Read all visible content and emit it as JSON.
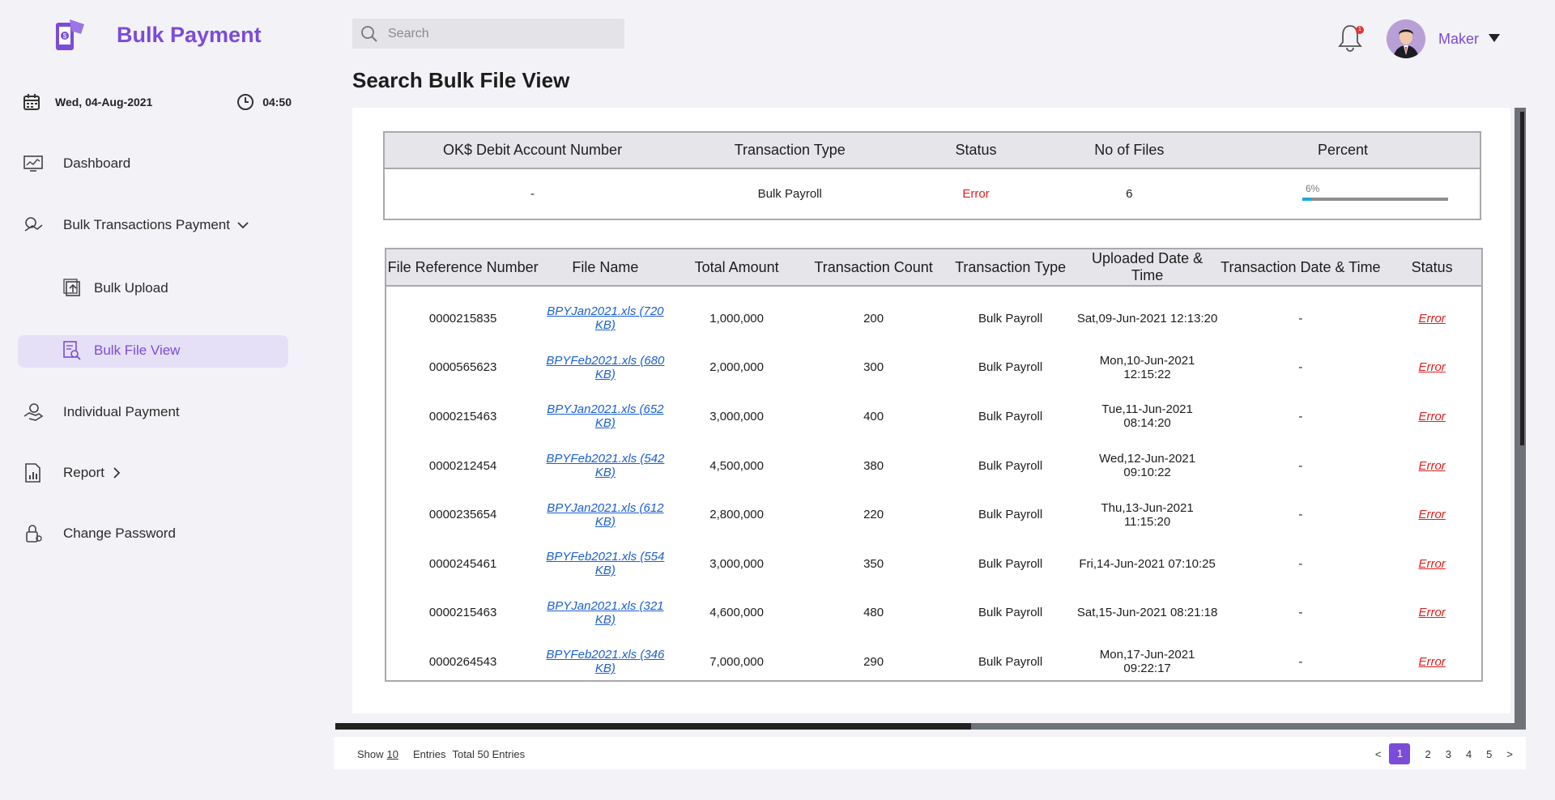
{
  "brand": {
    "title": "Bulk Payment"
  },
  "datebar": {
    "date": "Wed, 04-Aug-2021",
    "time": "04:50"
  },
  "sidebar": {
    "items": [
      {
        "label": "Dashboard"
      },
      {
        "label": "Bulk Transactions Payment"
      },
      {
        "label": "Bulk Upload"
      },
      {
        "label": "Bulk File View"
      },
      {
        "label": "Individual Payment"
      },
      {
        "label": "Report"
      },
      {
        "label": "Change Password"
      }
    ]
  },
  "search": {
    "placeholder": "Search"
  },
  "header": {
    "user": "Maker",
    "notification_count": "1"
  },
  "page": {
    "title": "Search Bulk File View"
  },
  "summary": {
    "headers": [
      "OK$ Debit Account Number",
      "Transaction Type",
      "Status",
      "No of Files",
      "Percent"
    ],
    "row": {
      "account": "-",
      "type": "Bulk Payroll",
      "status": "Error",
      "files": "6",
      "percent_label": "6%",
      "percent_value": 6
    }
  },
  "files": {
    "headers": [
      "File Reference Number",
      "File Name",
      "Total Amount",
      "Transaction Count",
      "Transaction Type",
      "Uploaded Date & Time",
      "Transaction Date & Time",
      "Status"
    ],
    "rows": [
      [
        "0000215835",
        "BPYJan2021.xls (720 KB)",
        "1,000,000",
        "200",
        "Bulk Payroll",
        "Sat,09-Jun-2021 12:13:20",
        "-",
        "Error"
      ],
      [
        "0000565623",
        "BPYFeb2021.xls (680 KB)",
        "2,000,000",
        "300",
        "Bulk Payroll",
        "Mon,10-Jun-2021 12:15:22",
        "-",
        "Error"
      ],
      [
        "0000215463",
        "BPYJan2021.xls (652 KB)",
        "3,000,000",
        "400",
        "Bulk Payroll",
        "Tue,11-Jun-2021 08:14:20",
        "-",
        "Error"
      ],
      [
        "0000212454",
        "BPYFeb2021.xls (542 KB)",
        "4,500,000",
        "380",
        "Bulk Payroll",
        "Wed,12-Jun-2021 09:10:22",
        "-",
        "Error"
      ],
      [
        "0000235654",
        "BPYJan2021.xls (612 KB)",
        "2,800,000",
        "220",
        "Bulk Payroll",
        "Thu,13-Jun-2021 11:15:20",
        "-",
        "Error"
      ],
      [
        "0000245461",
        "BPYFeb2021.xls (554 KB)",
        "3,000,000",
        "350",
        "Bulk Payroll",
        "Fri,14-Jun-2021 07:10:25",
        "-",
        "Error"
      ],
      [
        "0000215463",
        "BPYJan2021.xls (321 KB)",
        "4,600,000",
        "480",
        "Bulk Payroll",
        "Sat,15-Jun-2021 08:21:18",
        "-",
        "Error"
      ],
      [
        "0000264543",
        "BPYFeb2021.xls (346 KB)",
        "7,000,000",
        "290",
        "Bulk Payroll",
        "Mon,17-Jun-2021 09:22:17",
        "-",
        "Error"
      ]
    ]
  },
  "footer": {
    "show_label": "Show",
    "show_value": "10",
    "entries_label": "Entries",
    "total_label": "Total 50 Entries",
    "pages": [
      "<",
      "1",
      "2",
      "3",
      "4",
      "5",
      ">"
    ],
    "active_page": "1"
  },
  "colors": {
    "accent": "#7b4bd9",
    "error": "#e11d1d",
    "link": "#1a5fd0",
    "progress": "#19a8e0"
  }
}
